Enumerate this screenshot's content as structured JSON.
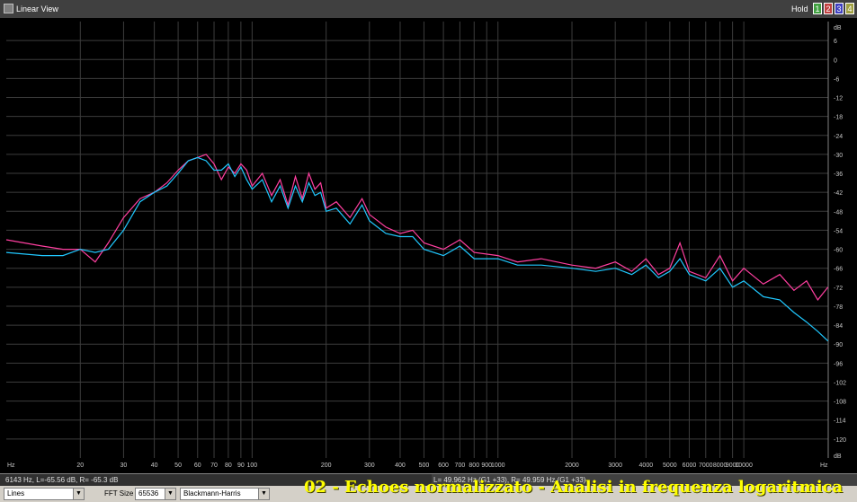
{
  "window": {
    "title": "Linear View",
    "hold_label": "Hold"
  },
  "buttons": [
    {
      "label": "1",
      "color": "#40a040"
    },
    {
      "label": "2",
      "color": "#c04040"
    },
    {
      "label": "3",
      "color": "#4040c0"
    },
    {
      "label": "4",
      "color": "#a0a040"
    }
  ],
  "status": {
    "cursor_readout": "6143 Hz, L=-65.56 dB, R= -65.3 dB",
    "peak_readout": "L= 49.962 Hz (G1 +33), R= 49.959 Hz (G1 +33)"
  },
  "controls": {
    "display_mode": "Lines",
    "fft_label": "FFT Size",
    "fft_size": "65536",
    "window": "Blackmann-Harris"
  },
  "caption": "02 - Echoes normalizzato - Analisi in frequenza logaritmica",
  "chart_data": {
    "type": "line",
    "xscale": "log",
    "xlim": [
      10,
      22050
    ],
    "ylim": [
      -126,
      12
    ],
    "x_unit": "Hz",
    "y_unit": "dB",
    "x_ticks": [
      20,
      30,
      40,
      50,
      60,
      70,
      80,
      90,
      100,
      200,
      300,
      400,
      500,
      600,
      700,
      800,
      900,
      1000,
      2000,
      3000,
      4000,
      5000,
      6000,
      7000,
      8000,
      9000,
      10000
    ],
    "x_tick_labels": [
      "20",
      "30",
      "40",
      "50",
      "60",
      "70",
      "80",
      "90",
      "100",
      "200",
      "300",
      "400",
      "500",
      "600",
      "700",
      "800",
      "900",
      "1000",
      "2000",
      "3000",
      "4000",
      "5000",
      "6000",
      "7000",
      "8000",
      "9000",
      "10000"
    ],
    "y_ticks": [
      6,
      0,
      -6,
      -12,
      -18,
      -24,
      -30,
      -36,
      -42,
      -48,
      -54,
      -60,
      -66,
      -72,
      -78,
      -84,
      -90,
      -96,
      -102,
      -108,
      -114,
      -120
    ],
    "y_tick_labels": [
      "6",
      "0",
      "-6",
      "-12",
      "-18",
      "-24",
      "-30",
      "-36",
      "-42",
      "-48",
      "-54",
      "-60",
      "-66",
      "-72",
      "-78",
      "-84",
      "-90",
      "-96",
      "-102",
      "-108",
      "-114",
      "-120"
    ],
    "grid": true,
    "series": [
      {
        "color": "#ff3fa0",
        "x": [
          10,
          14,
          17,
          20,
          23,
          26,
          30,
          35,
          40,
          45,
          50,
          55,
          60,
          65,
          70,
          75,
          80,
          85,
          90,
          95,
          100,
          110,
          120,
          130,
          140,
          150,
          160,
          170,
          180,
          190,
          200,
          220,
          250,
          280,
          300,
          350,
          400,
          450,
          500,
          600,
          700,
          800,
          1000,
          1200,
          1500,
          2000,
          2500,
          3000,
          3500,
          4000,
          4500,
          5000,
          5500,
          6000,
          7000,
          8000,
          9000,
          10000,
          12000,
          14000,
          16000,
          18000,
          20000,
          22000
        ],
        "y": [
          -57,
          -59,
          -60,
          -60,
          -64,
          -58,
          -50,
          -44,
          -42,
          -39,
          -35,
          -32,
          -31,
          -30,
          -33,
          -38,
          -34,
          -36,
          -33,
          -35,
          -40,
          -36,
          -43,
          -38,
          -46,
          -37,
          -44,
          -36,
          -41,
          -39,
          -47,
          -45,
          -50,
          -44,
          -49,
          -53,
          -55,
          -54,
          -58,
          -60,
          -57,
          -61,
          -62,
          -64,
          -63,
          -65,
          -66,
          -64,
          -67,
          -63,
          -68,
          -66,
          -58,
          -67,
          -69,
          -62,
          -70,
          -66,
          -71,
          -68,
          -73,
          -70,
          -76,
          -72
        ]
      },
      {
        "color": "#20c8ff",
        "x": [
          10,
          14,
          17,
          20,
          23,
          26,
          30,
          35,
          40,
          45,
          50,
          55,
          60,
          65,
          70,
          75,
          80,
          85,
          90,
          95,
          100,
          110,
          120,
          130,
          140,
          150,
          160,
          170,
          180,
          190,
          200,
          220,
          250,
          280,
          300,
          350,
          400,
          450,
          500,
          600,
          700,
          800,
          1000,
          1200,
          1500,
          2000,
          2500,
          3000,
          3500,
          4000,
          4500,
          5000,
          5500,
          6000,
          7000,
          8000,
          9000,
          10000,
          12000,
          14000,
          16000,
          18000,
          20000,
          22000
        ],
        "y": [
          -61,
          -62,
          -62,
          -60,
          -61,
          -60,
          -54,
          -45,
          -42,
          -40,
          -36,
          -32,
          -31,
          -32,
          -35,
          -35,
          -33,
          -37,
          -34,
          -38,
          -41,
          -38,
          -45,
          -40,
          -47,
          -40,
          -45,
          -39,
          -43,
          -42,
          -48,
          -47,
          -52,
          -46,
          -51,
          -55,
          -56,
          -56,
          -60,
          -62,
          -59,
          -63,
          -63,
          -65,
          -65,
          -66,
          -67,
          -66,
          -68,
          -65,
          -69,
          -67,
          -63,
          -68,
          -70,
          -66,
          -72,
          -70,
          -75,
          -76,
          -80,
          -83,
          -86,
          -89
        ]
      }
    ]
  }
}
